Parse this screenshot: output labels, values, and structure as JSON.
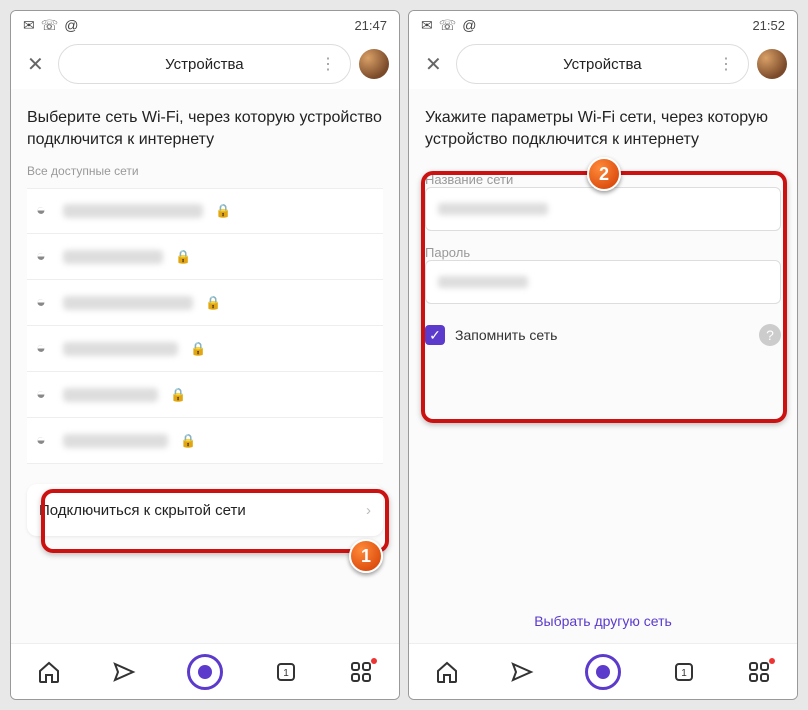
{
  "left": {
    "status": {
      "time": "21:47"
    },
    "appbar": {
      "title": "Устройства"
    },
    "heading": "Выберите сеть Wi-Fi, через которую устройство подключится к интернету",
    "section_label": "Все доступные сети",
    "hidden_network": "Подключиться к скрытой сети",
    "badge": "1"
  },
  "right": {
    "status": {
      "time": "21:52"
    },
    "appbar": {
      "title": "Устройства"
    },
    "heading": "Укажите параметры Wi-Fi сети, через которую устройство подключится к интернету",
    "field_ssid_label": "Название сети",
    "field_password_label": "Пароль",
    "remember_label": "Запомнить сеть",
    "alt_link": "Выбрать другую сеть",
    "badge": "2"
  }
}
